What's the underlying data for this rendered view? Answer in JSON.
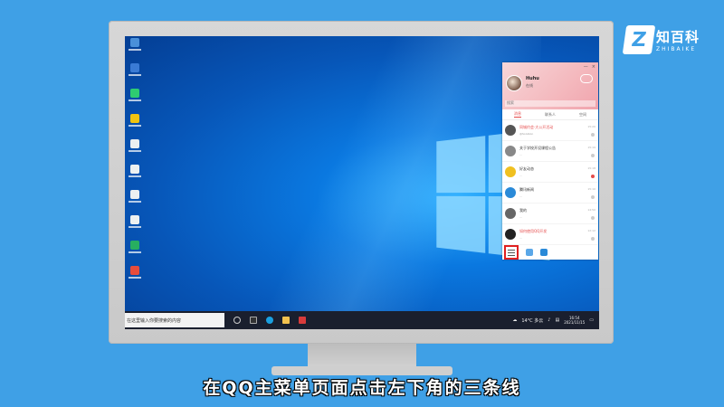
{
  "brand": {
    "name": "知百科",
    "sub": "ZHIBAIKE",
    "mark": "Z"
  },
  "subtitle": "在QQ主菜单页面点击左下角的三条线",
  "taskbar": {
    "search_placeholder": "在这里输入你要搜索的内容",
    "weather": "14°C 多云",
    "time": "16:54",
    "date": "2021/11/15"
  },
  "qq": {
    "name": "Huhu",
    "status": "在线",
    "search_placeholder": "搜索",
    "tabs": [
      "消息",
      "联系人",
      "空间"
    ],
    "items": [
      {
        "title": "同城约会·大公开活动",
        "sub": "@Solution",
        "time": "15:20",
        "icon_color": "#555",
        "red": true
      },
      {
        "title": "关于学校开设课程公告",
        "sub": "…",
        "time": "15:19",
        "icon_color": "#888",
        "red": false
      },
      {
        "title": "好友动态",
        "sub": "…",
        "time": "15:18",
        "icon_color": "#f0c020",
        "red": false
      },
      {
        "title": "腾讯新闻",
        "sub": "…",
        "time": "15:10",
        "icon_color": "#2a8ad8",
        "red": false
      },
      {
        "title": "我的",
        "sub": "…",
        "time": "14:50",
        "icon_color": "#666",
        "red": false
      },
      {
        "title": "如何使用QQ开发",
        "sub": "…",
        "time": "12:12",
        "icon_color": "#222",
        "red": true
      }
    ]
  },
  "colors": {
    "accent": "#e54b4b",
    "bg": "#3fa0e6",
    "highlight": "#e02020"
  }
}
